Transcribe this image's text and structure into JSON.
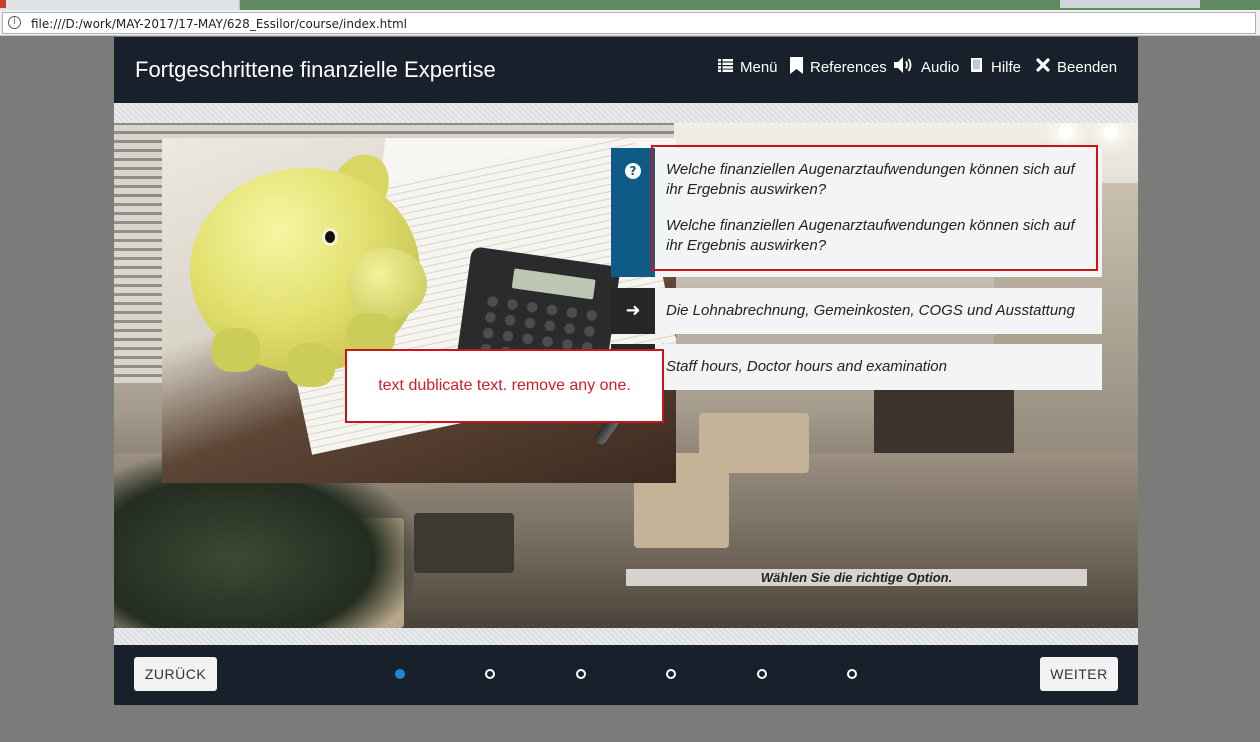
{
  "browser": {
    "info_glyph": "i",
    "url": "file:///D:/work/MAY-2017/17-MAY/628_Essilor/course/index.html"
  },
  "course": {
    "title": "Fortgeschrittene finanzielle Expertise",
    "nav": [
      {
        "label": "Menü",
        "icon": "list-icon"
      },
      {
        "label": "References",
        "icon": "bookmark-icon"
      },
      {
        "label": "Audio",
        "icon": "speaker-icon"
      },
      {
        "label": "Hilfe",
        "icon": "book-icon"
      },
      {
        "label": "Beenden",
        "icon": "close-icon"
      }
    ]
  },
  "question": {
    "icon_glyph": "?",
    "text_1": "Welche finanziellen Augenarztaufwendungen können sich auf ihr Ergebnis auswirken?",
    "text_2": "Welche finanziellen Augenarztaufwendungen können sich auf ihr Ergebnis auswirken?"
  },
  "options": [
    {
      "arrow": "➜",
      "label": "Die Lohnabrechnung, Gemeinkosten, COGS und Ausstattung"
    },
    {
      "arrow": "➜",
      "label": "Staff hours, Doctor hours and examination"
    }
  ],
  "instruction": "Wählen Sie die richtige Option.",
  "review_comment": "text dublicate text. remove any one.",
  "footer": {
    "back_label": "ZURÜCK",
    "next_label": "WEITER",
    "pages_total": 6,
    "current_page": 1
  },
  "colors": {
    "header_bg": "#18202c",
    "question_accent": "#0f5a87",
    "review_red": "#c9141c",
    "active_dot": "#1e86d6"
  }
}
